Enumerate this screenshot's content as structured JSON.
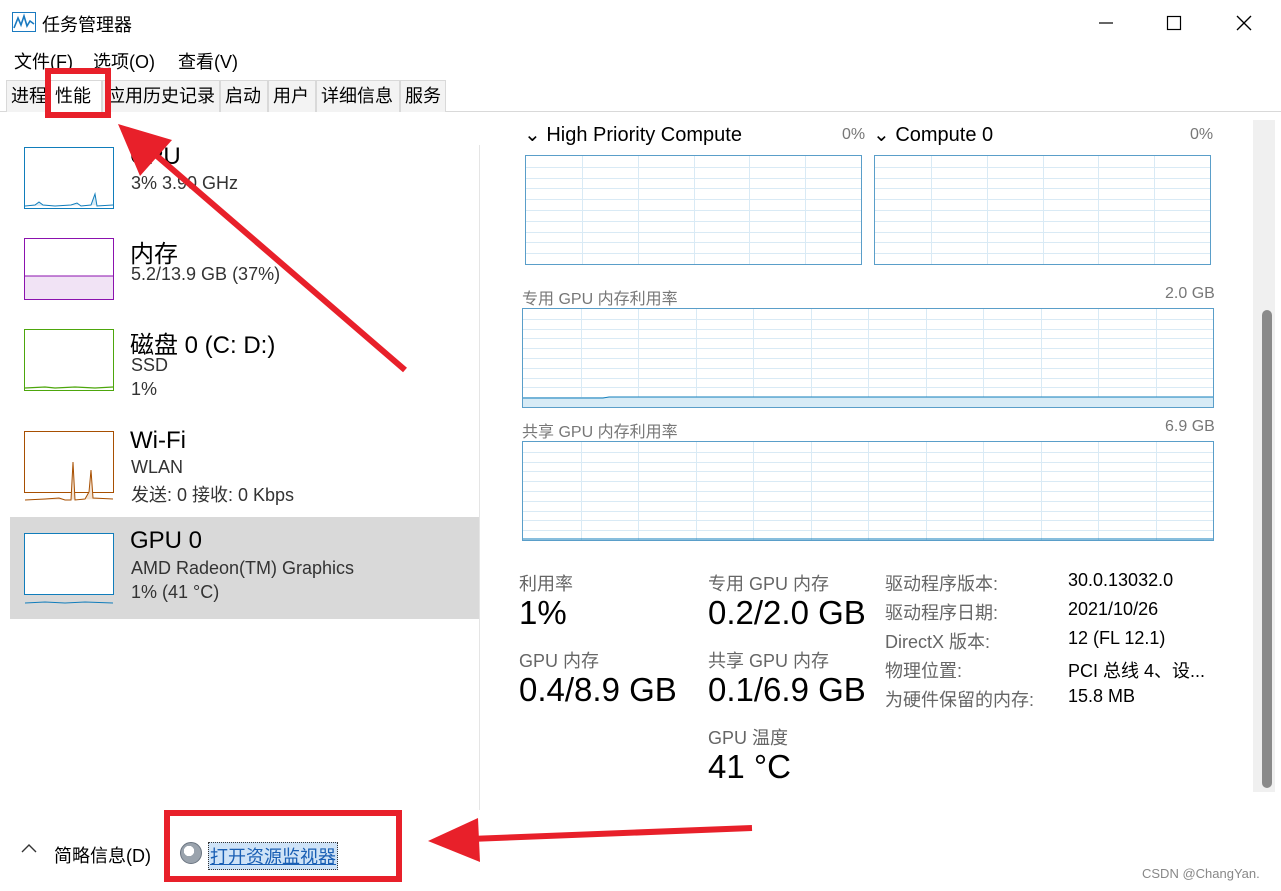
{
  "window": {
    "title": "任务管理器",
    "controls": {
      "minimize": "—",
      "maximize": "☐",
      "close": "✕"
    }
  },
  "menu": {
    "file": "文件(F)",
    "options": "选项(O)",
    "view": "查看(V)"
  },
  "tabs": [
    "进程",
    "性能",
    "应用历史记录",
    "启动",
    "用户",
    "详细信息",
    "服务"
  ],
  "active_tab": "性能",
  "perf_list": [
    {
      "name": "CPU",
      "line1": "3%  3.90 GHz",
      "line2": "",
      "color": "#117dbb",
      "selected": false
    },
    {
      "name": "内存",
      "line1": "5.2/13.9 GB (37%)",
      "line2": "",
      "color": "#8b12ae",
      "selected": false
    },
    {
      "name": "磁盘 0 (C: D:)",
      "line1": "SSD",
      "line2": "1%",
      "color": "#4da60c",
      "selected": false
    },
    {
      "name": "Wi-Fi",
      "line1": "WLAN",
      "line2": "发送: 0 接收: 0 Kbps",
      "color": "#a74f01",
      "selected": false
    },
    {
      "name": "GPU 0",
      "line1": "AMD Radeon(TM) Graphics",
      "line2": "1% (41 °C)",
      "color": "#117dbb",
      "selected": true
    }
  ],
  "gpu_panel": {
    "engines": [
      {
        "name": "High Priority Compute",
        "percent": "0%",
        "chevron": "⌄"
      },
      {
        "name": "Compute 0",
        "percent": "0%",
        "chevron": "⌄"
      }
    ],
    "dedicated_mem_chart": {
      "label": "专用 GPU 内存利用率",
      "max": "2.0 GB"
    },
    "shared_mem_chart": {
      "label": "共享 GPU 内存利用率",
      "max": "6.9 GB"
    },
    "stats": {
      "utilization_label": "利用率",
      "utilization_value": "1%",
      "gpu_mem_label": "GPU 内存",
      "gpu_mem_value": "0.4/8.9 GB",
      "dedicated_label": "专用 GPU 内存",
      "dedicated_value": "0.2/2.0 GB",
      "shared_label": "共享 GPU 内存",
      "shared_value": "0.1/6.9 GB",
      "temp_label": "GPU 温度",
      "temp_value": "41 °C"
    },
    "info": [
      {
        "key": "驱动程序版本:",
        "value": "30.0.13032.0"
      },
      {
        "key": "驱动程序日期:",
        "value": "2021/10/26"
      },
      {
        "key": "DirectX 版本:",
        "value": "12 (FL 12.1)"
      },
      {
        "key": "物理位置:",
        "value": "PCI 总线 4、设..."
      },
      {
        "key": "为硬件保留的内存:",
        "value": "15.8 MB"
      }
    ],
    "colors": {
      "chart_border": "#5a9ec9",
      "grid": "#d9eaf5"
    }
  },
  "bottom": {
    "brief": "简略信息(D)",
    "resource_monitor": "打开资源监视器"
  },
  "watermark": "CSDN @ChangYan.",
  "annotations": {
    "color": "#e8202a"
  }
}
